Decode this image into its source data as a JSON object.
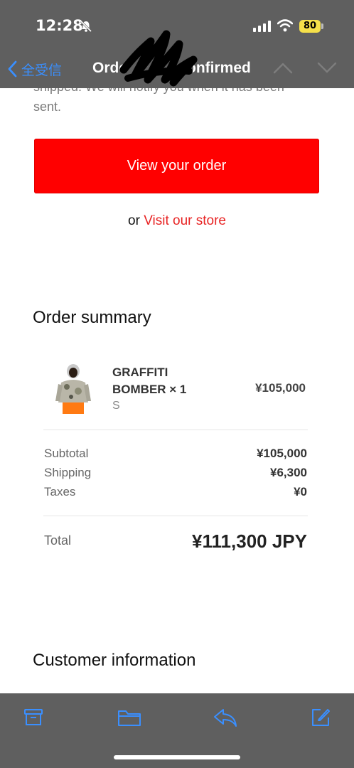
{
  "status_bar": {
    "time": "12:28",
    "battery": "80",
    "icons": [
      "bell-muted-icon",
      "signal-icon",
      "wifi-icon",
      "battery-icon"
    ]
  },
  "mail_nav": {
    "back_label": "全受信",
    "title_left": "Orde",
    "title_right": "onfirmed",
    "icons": [
      "chevron-left-icon",
      "chevron-up-icon",
      "chevron-down-icon"
    ]
  },
  "email": {
    "intro_text": "shipped. We will notify you when it has been sent.",
    "cta_label": "View your order",
    "or_text": "or",
    "store_link": "Visit our store",
    "order_summary_title": "Order summary",
    "item": {
      "name": "GRAFFITI BOMBER × 1",
      "variant": "S",
      "price": "¥105,000"
    },
    "subtotal_label": "Subtotal",
    "subtotal_value": "¥105,000",
    "shipping_label": "Shipping",
    "shipping_value": "¥6,300",
    "taxes_label": "Taxes",
    "taxes_value": "¥0",
    "total_label": "Total",
    "total_value": "¥111,300 JPY",
    "customer_info_title": "Customer information"
  },
  "colors": {
    "accent_red": "#ff0000",
    "link_red": "#e82424",
    "ios_blue": "#3a8fff",
    "bar_gray": "#5f5f5f",
    "battery_yellow": "#f5e04a"
  },
  "toolbar": {
    "icons": [
      "archive-icon",
      "folder-icon",
      "reply-icon",
      "compose-icon"
    ]
  }
}
